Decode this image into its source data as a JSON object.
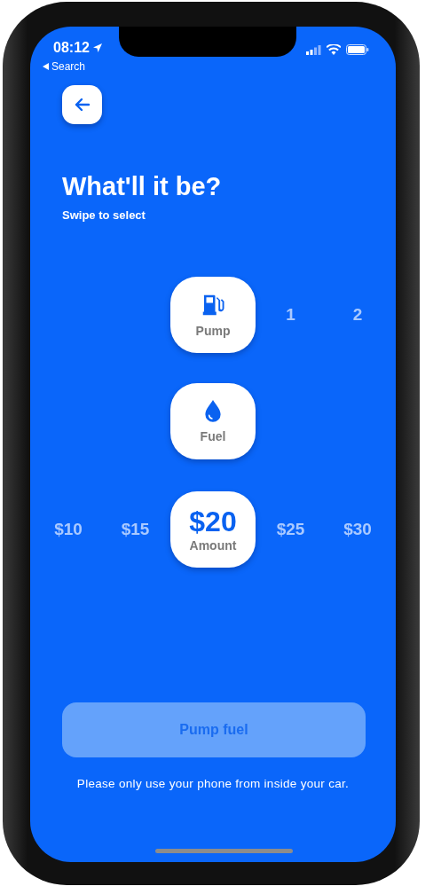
{
  "status_bar": {
    "time": "08:12",
    "back_link": "Search"
  },
  "header": {
    "title": "What'll it be?",
    "subtitle": "Swipe to select"
  },
  "selectors": [
    {
      "kind": "pump",
      "label": "Pump",
      "after": [
        "1",
        "2"
      ]
    },
    {
      "kind": "fuel",
      "label": "Fuel"
    },
    {
      "kind": "amount",
      "label": "Amount",
      "value": "$20",
      "before": [
        "$10",
        "$15"
      ],
      "after": [
        "$25",
        "$30"
      ]
    }
  ],
  "action_button": {
    "label": "Pump fuel",
    "disabled": true
  },
  "footer_note": "Please only use your phone from inside your car."
}
